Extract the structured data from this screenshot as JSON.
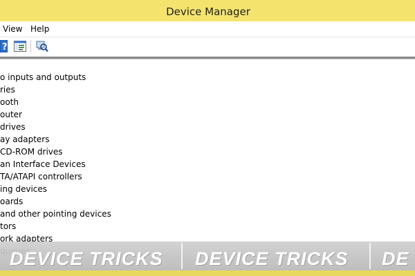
{
  "window": {
    "title": "Device Manager"
  },
  "menu": {
    "items": [
      {
        "label": "View"
      },
      {
        "label": "Help"
      }
    ]
  },
  "toolbar": {
    "buttons": [
      {
        "icon": "help-icon",
        "glyph": "?"
      },
      {
        "icon": "console-tree-icon"
      },
      {
        "icon": "scan-hardware-icon"
      }
    ]
  },
  "tree": {
    "items": [
      {
        "label": "o inputs and outputs"
      },
      {
        "label": "ries"
      },
      {
        "label": "ooth"
      },
      {
        "label": "outer"
      },
      {
        "label": "drives"
      },
      {
        "label": "ay adapters"
      },
      {
        "label": "CD-ROM drives"
      },
      {
        "label": "an Interface Devices"
      },
      {
        "label": "TA/ATAPI controllers"
      },
      {
        "label": "ing devices"
      },
      {
        "label": "oards"
      },
      {
        "label": " and other pointing devices"
      },
      {
        "label": "tors"
      },
      {
        "label": "ork adapters"
      },
      {
        "label": "queues"
      }
    ]
  },
  "watermark": {
    "texts": [
      "DEVICE TRICKS",
      "DEVICE TRICKS",
      "DE"
    ]
  },
  "colors": {
    "titlebar": "#f4e46e",
    "accent_blue": "#1f5fb8"
  }
}
